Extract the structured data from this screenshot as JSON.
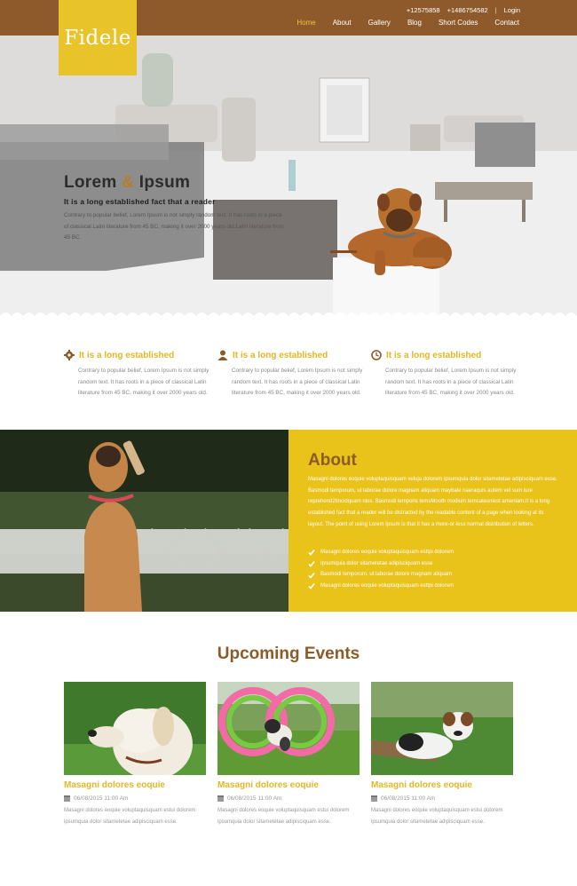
{
  "brand": {
    "logo": "Fidele"
  },
  "header": {
    "phone1": "+12575858",
    "phone2": "+1486754582",
    "separator": "|",
    "login": "Login",
    "nav": [
      "Home",
      "About",
      "Gallery",
      "Blog",
      "Short Codes",
      "Contact"
    ]
  },
  "hero": {
    "title_a": "Lorem",
    "title_amp": "&",
    "title_b": "Ipsum",
    "subtitle": "It is a long established fact that a reader",
    "text": "Contrary to popular belief, Lorem Ipsum is not simply random text. It has roots in a piece of classical Latin literature from 45 BC, making it over 2000 years old.Latin literature from 45 BC."
  },
  "features": [
    {
      "icon": "gear-icon",
      "title": "It is a long established",
      "text": "Contrary to popular belief, Lorem Ipsum is not simply random text. It has roots in a piece of classical Latin literature from 45 BC, making it over 2000 years old."
    },
    {
      "icon": "user-icon",
      "title": "It is a long established",
      "text": "Contrary to popular belief, Lorem Ipsum is not simply random text. It has roots in a piece of classical Latin literature from 45 BC, making it over 2000 years old."
    },
    {
      "icon": "clock-icon",
      "title": "It is a long established",
      "text": "Contrary to popular belief, Lorem Ipsum is not simply random text. It has roots in a piece of classical Latin literature from 45 BC, making it over 2000 years old."
    }
  ],
  "about": {
    "title": "About",
    "text": "Masagni dolores eoquie voluptaquisquam veluja dolorem ipsumquia dolor sitametetae adipisciquam esse. Basmodi temporum, ut laborae dolore magnam aliquam maybale naeraquis autem vel sum iure reprehend2tincidquam nios. Basmodi temporis temsMooth modium temcatesniest ameniam.It is a long established fact that a reader will be distracted by the readable content of a page when looking at its layout. The point of using Lorem Ipsum is that it has a more-or-less normal distribution of letters.",
    "list": [
      "Masagni dolores eoquie voluptaquisquam esttpi dolorem",
      "Ipsumquia dolor sitametetae adipisciquam esse",
      "Basmodi temporum, ut laborae dolore magnam aliquam",
      "Masagni dolores eoquie voluptaquisquam esttpi dolorem"
    ]
  },
  "events": {
    "title": "Upcoming Events",
    "items": [
      {
        "title": "Masagni dolores eoquie",
        "date": "06/08/2015 11:00 Am",
        "text": "Masagni dolores eoquie voluptaquisquam estui dolorem ipsumquia dolor sitametetae adipisciquam esse."
      },
      {
        "title": "Masagni dolores eoquie",
        "date": "06/08/2015 11:00 Am",
        "text": "Masagni dolores eoquie voluptaquisquam estui dolorem ipsumquia dolor sitametetae adipisciquam esse."
      },
      {
        "title": "Masagni dolores eoquie",
        "date": "06/08/2015 11:00 Am",
        "text": "Masagni dolores eoquie voluptaquisquam estui dolorem ipsumquia dolor sitametetae adipisciquam esse."
      }
    ]
  },
  "colors": {
    "brown": "#8e5a2b",
    "yellow": "#e9c21a",
    "accent": "#e3b724",
    "title_brown": "#8c5b28"
  }
}
